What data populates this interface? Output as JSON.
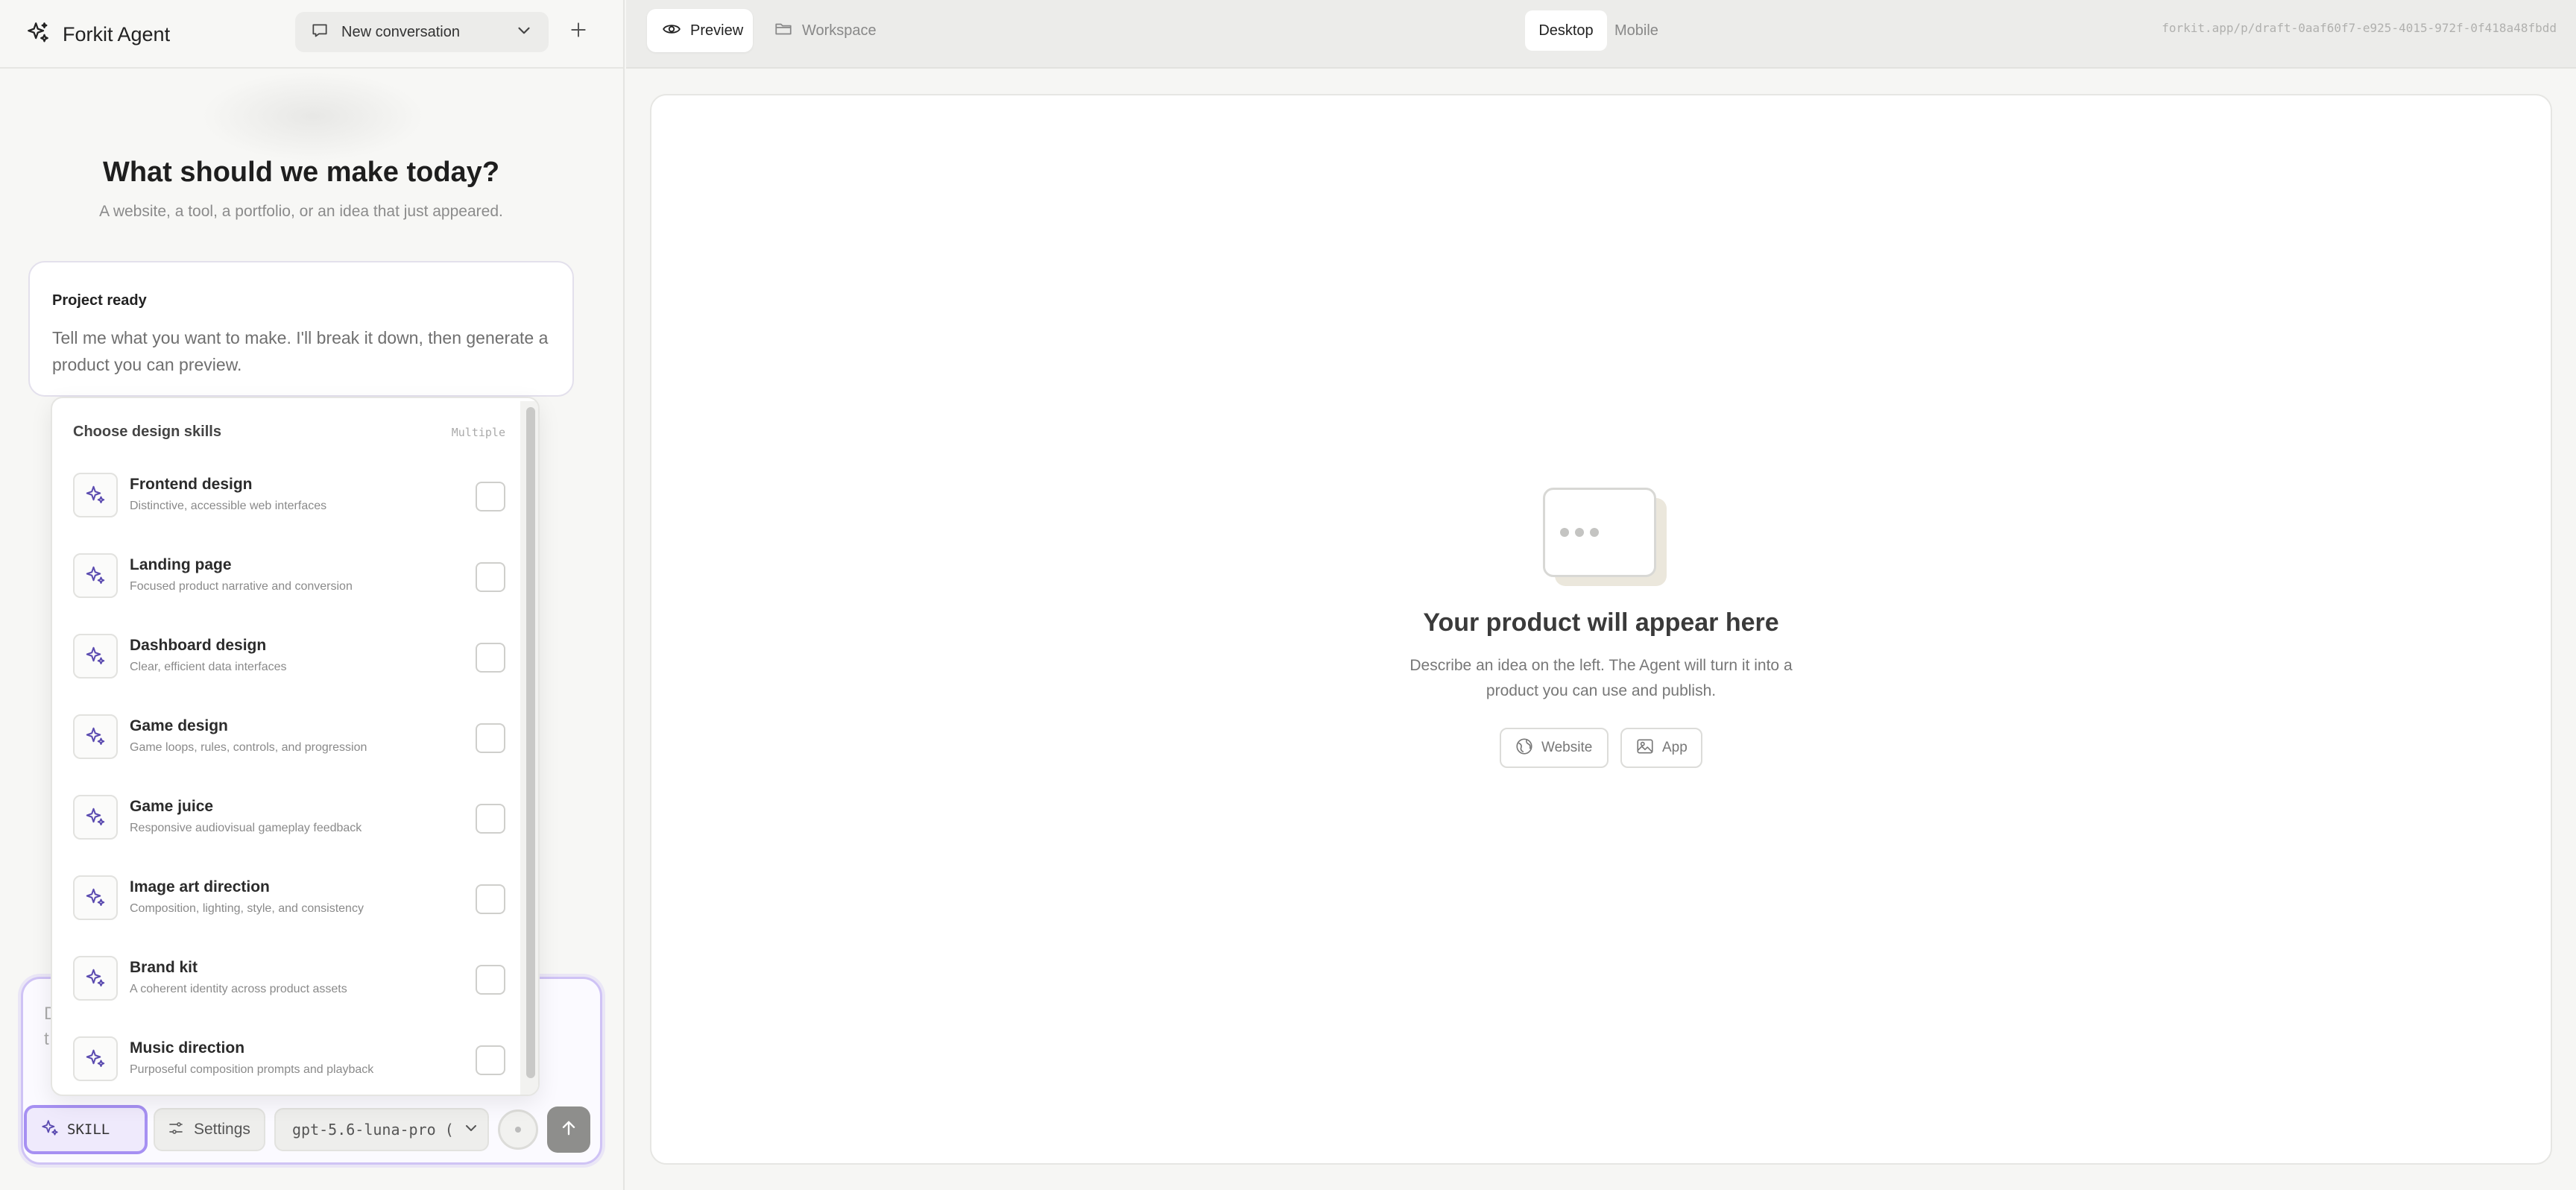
{
  "header": {
    "brand": "Forkit Agent",
    "conversation": "New conversation"
  },
  "hero": {
    "title": "What should we make today?",
    "subtitle": "A website, a tool, a portfolio, or an idea that just appeared."
  },
  "project_card": {
    "title": "Project ready",
    "body": "Tell me what you want to make. I'll break it down, then generate a product you can preview."
  },
  "skills_menu": {
    "title": "Choose design skills",
    "mode": "Multiple",
    "items": [
      {
        "name": "Frontend design",
        "desc": "Distinctive, accessible web interfaces",
        "checked": false
      },
      {
        "name": "Landing page",
        "desc": "Focused product narrative and conversion",
        "checked": false
      },
      {
        "name": "Dashboard design",
        "desc": "Clear, efficient data interfaces",
        "checked": false
      },
      {
        "name": "Game design",
        "desc": "Game loops, rules, controls, and progression",
        "checked": false
      },
      {
        "name": "Game juice",
        "desc": "Responsive audiovisual gameplay feedback",
        "checked": false
      },
      {
        "name": "Image art direction",
        "desc": "Composition, lighting, style, and consistency",
        "checked": false
      },
      {
        "name": "Brand kit",
        "desc": "A coherent identity across product assets",
        "checked": false
      },
      {
        "name": "Music direction",
        "desc": "Purposeful composition prompts and playback",
        "checked": false
      }
    ]
  },
  "composer": {
    "text_fragment": "D\nt",
    "skill_label": "SKILL",
    "settings_label": "Settings",
    "model": "gpt-5.6-luna-pro ("
  },
  "preview_bar": {
    "tab_preview": "Preview",
    "tab_workspace": "Workspace",
    "view_desktop": "Desktop",
    "view_mobile": "Mobile",
    "url": "forkit.app/p/draft-0aaf60f7-e925-4015-972f-0f418a48fbdd"
  },
  "empty_state": {
    "title": "Your product will appear here",
    "desc": "Describe an idea on the left. The Agent will turn it into a product you can use and publish.",
    "chip_website": "Website",
    "chip_app": "App"
  },
  "icons": {
    "brand": "sparkle-icon",
    "conversation": "chat-bubble-icon",
    "dropdown": "chevron-down-icon",
    "new": "plus-icon",
    "preview": "eye-icon",
    "workspace": "folder-icon",
    "skill": "sparkle-icon",
    "settings": "sliders-icon",
    "send": "arrow-up-icon",
    "website": "globe-icon",
    "app": "image-icon"
  },
  "colors": {
    "accent": "#a690f2",
    "accent_soft": "#efeafc",
    "skill_icon": "#5b4bb0"
  }
}
